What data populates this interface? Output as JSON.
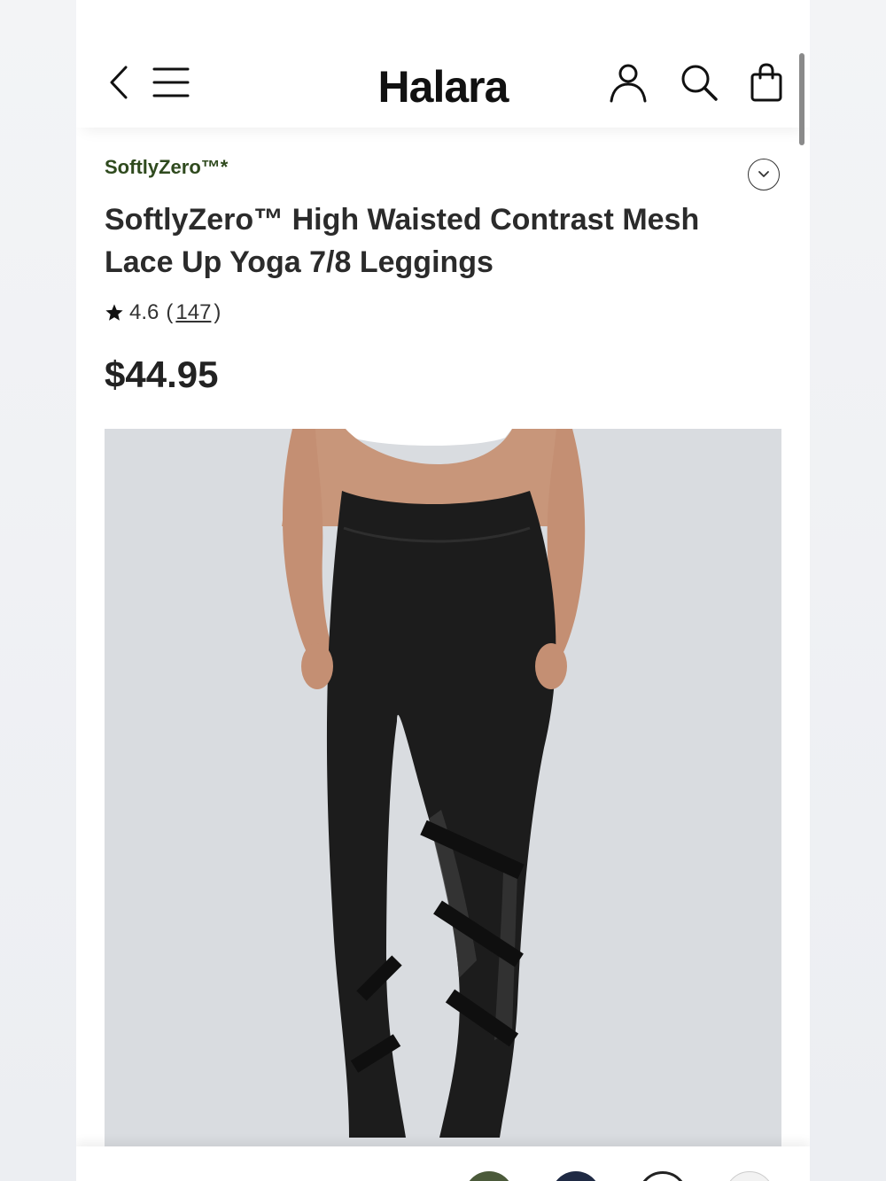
{
  "header": {
    "brand": "Halara",
    "icons": [
      "back-icon",
      "menu-icon",
      "account-icon",
      "search-icon",
      "shopping-bag-icon"
    ]
  },
  "product": {
    "collection": "SoftlyZero™*",
    "title": "SoftlyZero™ High Waisted Contrast Mesh Lace Up Yoga 7/8 Leggings",
    "rating": "4.6",
    "review_open": "(",
    "review_count": "147",
    "review_close": ")",
    "price": "$44.95"
  },
  "colors": {
    "collection_text": "#2f4a1e",
    "image_background": "#d9dce0",
    "swatches": [
      "#4b5a3a",
      "#1f2a44",
      "#ffffff",
      "#f2f2f2"
    ]
  }
}
